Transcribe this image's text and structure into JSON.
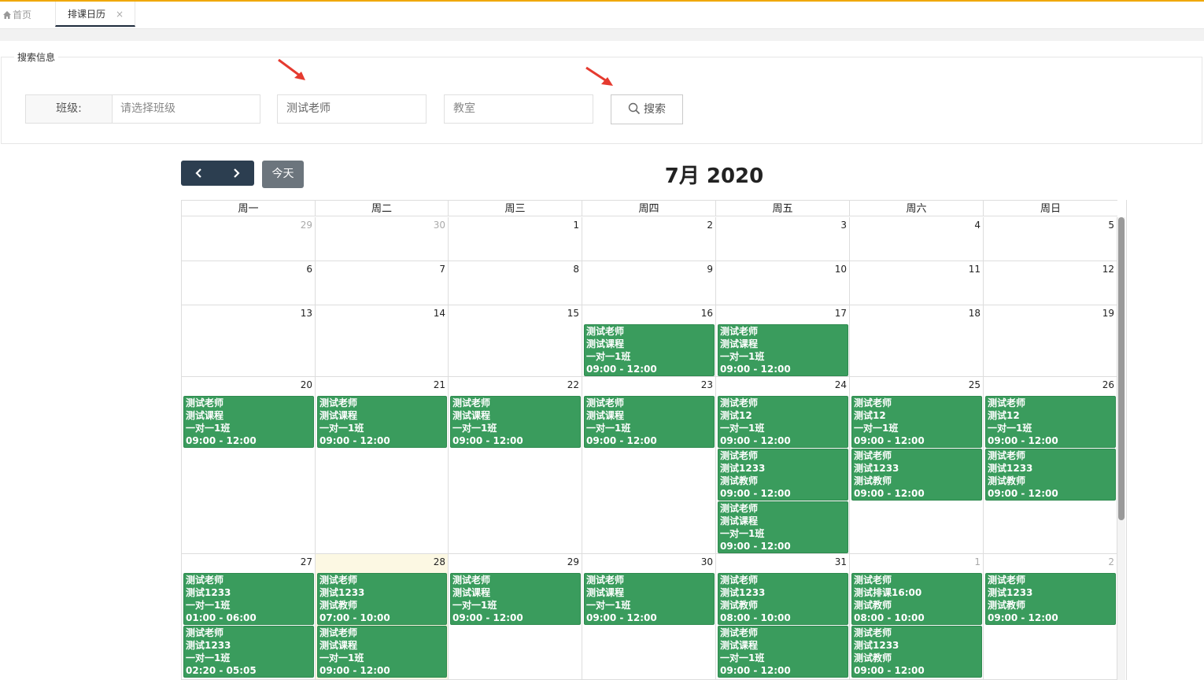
{
  "tabs": {
    "home_label": "首页",
    "calendar_label": "排课日历",
    "close_glyph": "×"
  },
  "search": {
    "legend": "搜索信息",
    "class_label": "班级:",
    "class_placeholder": "请选择班级",
    "teacher_value": "测试老师",
    "room_placeholder": "教室",
    "search_button": "搜索"
  },
  "toolbar": {
    "prev_glyph": "‹",
    "next_glyph": "›",
    "today_label": "今天",
    "title": "7月 2020"
  },
  "colors": {
    "accent_top": "#f0a800",
    "event_bg": "#3a9c5d",
    "nav_bg": "#2c3e50",
    "today_bg": "#fcf8e3",
    "arrow": "#e53a2f"
  },
  "calendar": {
    "weekdays": [
      "周一",
      "周二",
      "周三",
      "周四",
      "周五",
      "周六",
      "周日"
    ],
    "weeks": [
      {
        "days": [
          {
            "n": "29",
            "other": true
          },
          {
            "n": "30",
            "other": true
          },
          {
            "n": "1"
          },
          {
            "n": "2"
          },
          {
            "n": "3"
          },
          {
            "n": "4"
          },
          {
            "n": "5"
          }
        ]
      },
      {
        "days": [
          {
            "n": "6"
          },
          {
            "n": "7"
          },
          {
            "n": "8"
          },
          {
            "n": "9"
          },
          {
            "n": "10"
          },
          {
            "n": "11"
          },
          {
            "n": "12"
          }
        ]
      },
      {
        "days": [
          {
            "n": "13"
          },
          {
            "n": "14"
          },
          {
            "n": "15"
          },
          {
            "n": "16"
          },
          {
            "n": "17"
          },
          {
            "n": "18"
          },
          {
            "n": "19"
          }
        ]
      },
      {
        "days": [
          {
            "n": "20"
          },
          {
            "n": "21"
          },
          {
            "n": "22"
          },
          {
            "n": "23"
          },
          {
            "n": "24"
          },
          {
            "n": "25"
          },
          {
            "n": "26"
          }
        ]
      },
      {
        "days": [
          {
            "n": "27"
          },
          {
            "n": "28",
            "today": true
          },
          {
            "n": "29"
          },
          {
            "n": "30"
          },
          {
            "n": "31"
          },
          {
            "n": "1",
            "other": true
          },
          {
            "n": "2",
            "other": true
          }
        ]
      }
    ],
    "events": [
      {
        "week": 2,
        "day": 3,
        "slot": 0,
        "lines": [
          "测试老师",
          "测试课程",
          "一对一1班",
          "09:00 - 12:00"
        ]
      },
      {
        "week": 2,
        "day": 4,
        "slot": 0,
        "lines": [
          "测试老师",
          "测试课程",
          "一对一1班",
          "09:00 - 12:00"
        ]
      },
      {
        "week": 3,
        "day": 0,
        "slot": 0,
        "lines": [
          "测试老师",
          "测试课程",
          "一对一1班",
          "09:00 - 12:00"
        ]
      },
      {
        "week": 3,
        "day": 1,
        "slot": 0,
        "lines": [
          "测试老师",
          "测试课程",
          "一对一1班",
          "09:00 - 12:00"
        ]
      },
      {
        "week": 3,
        "day": 2,
        "slot": 0,
        "lines": [
          "测试老师",
          "测试课程",
          "一对一1班",
          "09:00 - 12:00"
        ]
      },
      {
        "week": 3,
        "day": 3,
        "slot": 0,
        "lines": [
          "测试老师",
          "测试课程",
          "一对一1班",
          "09:00 - 12:00"
        ]
      },
      {
        "week": 3,
        "day": 4,
        "slot": 0,
        "lines": [
          "测试老师",
          "测试12",
          "一对一1班",
          "09:00 - 12:00"
        ]
      },
      {
        "week": 3,
        "day": 4,
        "slot": 1,
        "lines": [
          "测试老师",
          "测试1233",
          "测试教师",
          "09:00 - 12:00"
        ]
      },
      {
        "week": 3,
        "day": 4,
        "slot": 2,
        "lines": [
          "测试老师",
          "测试课程",
          "一对一1班",
          "09:00 - 12:00"
        ]
      },
      {
        "week": 3,
        "day": 5,
        "slot": 0,
        "lines": [
          "测试老师",
          "测试12",
          "一对一1班",
          "09:00 - 12:00"
        ]
      },
      {
        "week": 3,
        "day": 5,
        "slot": 1,
        "lines": [
          "测试老师",
          "测试1233",
          "测试教师",
          "09:00 - 12:00"
        ]
      },
      {
        "week": 3,
        "day": 6,
        "slot": 0,
        "lines": [
          "测试老师",
          "测试12",
          "一对一1班",
          "09:00 - 12:00"
        ]
      },
      {
        "week": 3,
        "day": 6,
        "slot": 1,
        "lines": [
          "测试老师",
          "测试1233",
          "测试教师",
          "09:00 - 12:00"
        ]
      },
      {
        "week": 4,
        "day": 0,
        "slot": 0,
        "lines": [
          "测试老师",
          "测试1233",
          "一对一1班",
          "01:00 - 06:00"
        ]
      },
      {
        "week": 4,
        "day": 0,
        "slot": 1,
        "lines": [
          "测试老师",
          "测试1233",
          "一对一1班",
          "02:20 - 05:05"
        ]
      },
      {
        "week": 4,
        "day": 1,
        "slot": 0,
        "lines": [
          "测试老师",
          "测试1233",
          "测试教师",
          "07:00 - 10:00"
        ]
      },
      {
        "week": 4,
        "day": 1,
        "slot": 1,
        "lines": [
          "测试老师",
          "测试课程",
          "一对一1班",
          "09:00 - 12:00"
        ]
      },
      {
        "week": 4,
        "day": 2,
        "slot": 0,
        "lines": [
          "测试老师",
          "测试课程",
          "一对一1班",
          "09:00 - 12:00"
        ]
      },
      {
        "week": 4,
        "day": 3,
        "slot": 0,
        "lines": [
          "测试老师",
          "测试课程",
          "一对一1班",
          "09:00 - 12:00"
        ]
      },
      {
        "week": 4,
        "day": 4,
        "slot": 0,
        "lines": [
          "测试老师",
          "测试1233",
          "测试教师",
          "08:00 - 10:00"
        ]
      },
      {
        "week": 4,
        "day": 4,
        "slot": 1,
        "lines": [
          "测试老师",
          "测试课程",
          "一对一1班",
          "09:00 - 12:00"
        ]
      },
      {
        "week": 4,
        "day": 5,
        "slot": 0,
        "lines": [
          "测试老师",
          "测试排课16:00",
          "测试教师",
          "08:00 - 10:00"
        ]
      },
      {
        "week": 4,
        "day": 5,
        "slot": 1,
        "lines": [
          "测试老师",
          "测试1233",
          "测试教师",
          "09:00 - 12:00"
        ]
      },
      {
        "week": 4,
        "day": 6,
        "slot": 0,
        "lines": [
          "测试老师",
          "测试1233",
          "测试教师",
          "09:00 - 12:00"
        ]
      }
    ]
  }
}
